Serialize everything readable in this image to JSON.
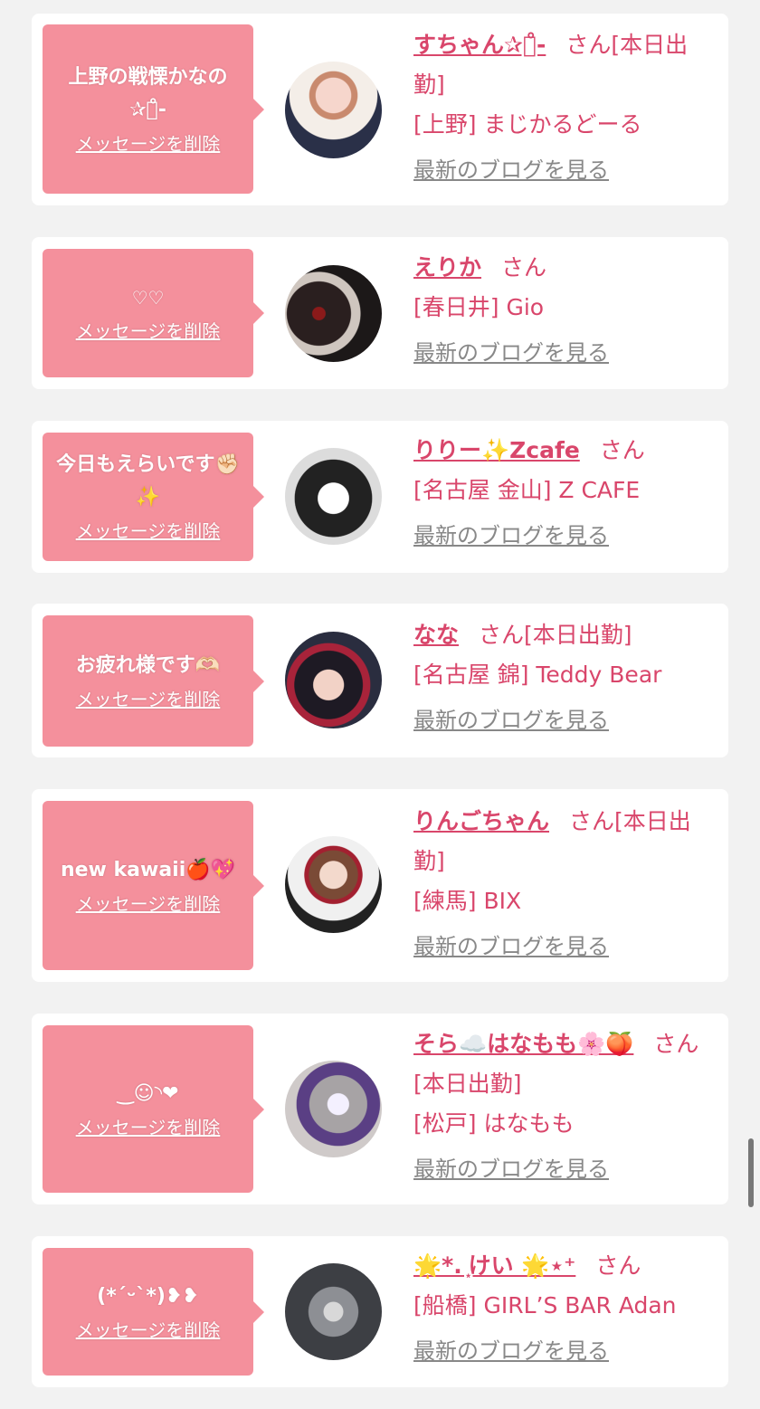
{
  "common": {
    "delete_label": "メッセージを削除",
    "blog_label": "最新のブログを見る",
    "san": "さん"
  },
  "items": [
    {
      "message": "上野の戦慄かなの ✰͙̊-",
      "name": "すちゃん✰͙̊-",
      "status": "[本日出勤]",
      "area": "[上野] まじかるどーる"
    },
    {
      "message": "♡♡",
      "name": "えりか",
      "status": "",
      "area": "[春日井] Gio"
    },
    {
      "message": "今日もえらいです✊🏻✨",
      "name": "りりー✨Zcafe",
      "status": "",
      "area": "[名古屋 金山] Z CAFE"
    },
    {
      "message": "お疲れ様です🫶🏻",
      "name": "なな",
      "status": "[本日出勤]",
      "area": "[名古屋 錦] Teddy Bear"
    },
    {
      "message": "new kawaii🍎💖",
      "name": "りんごちゃん",
      "status": "[本日出勤]",
      "area": "[練馬] BIX"
    },
    {
      "message": "‿☺︎︎◝❤︎︎",
      "name": "そら☁️はなもも🌸🍑",
      "status": "[本日出勤]",
      "area": "[松戸] はなもも"
    },
    {
      "message": "(*ˊᵕˋ*)❥❥",
      "name": "🌟*. ͙けい 🌟⋆⁺",
      "status": "",
      "area": "[船橋] GIRL’S BAR Adan"
    }
  ],
  "colors": {
    "bubble": "#f4909c",
    "accent": "#d9466b",
    "muted": "#888888",
    "background": "#f2f2f2"
  }
}
